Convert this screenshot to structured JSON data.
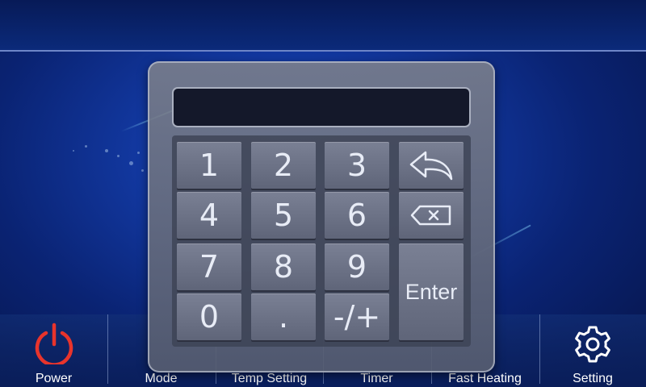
{
  "keypad": {
    "display_value": "",
    "keys": {
      "k1": "1",
      "k2": "2",
      "k3": "3",
      "k4": "4",
      "k5": "5",
      "k6": "6",
      "k7": "7",
      "k8": "8",
      "k9": "9",
      "k0": "0",
      "dot": ".",
      "sign": "-/+",
      "enter": "Enter"
    },
    "icons": {
      "back": "back-arrow-icon",
      "clear": "backspace-icon"
    }
  },
  "bottom_bar": {
    "power": "Power",
    "mode": "Mode",
    "temp_setting": "Temp Setting",
    "timer": "Timer",
    "fast_heating": "Fast Heating",
    "setting": "Setting"
  },
  "colors": {
    "power_icon": "#e8342c",
    "accent_blue": "#1238a0"
  }
}
